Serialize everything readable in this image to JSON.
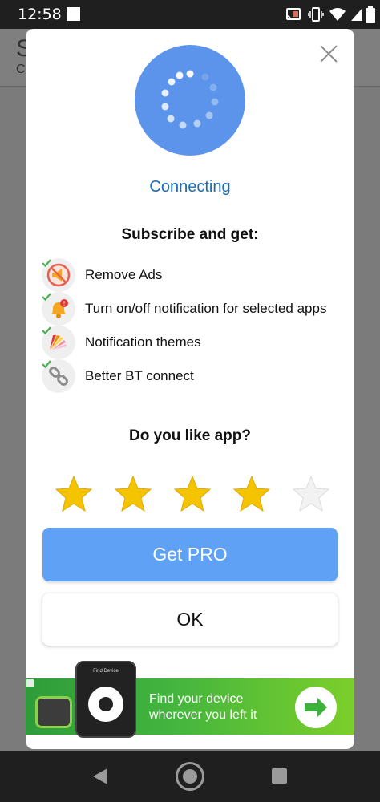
{
  "status_bar": {
    "time": "12:58",
    "icons": [
      "notification-square-icon",
      "cast-icon",
      "vibrate-icon",
      "wifi-icon",
      "signal-icon",
      "battery-icon"
    ]
  },
  "background_app": {
    "title_fragment": "S",
    "subtitle_fragment": "C"
  },
  "dialog": {
    "status_text": "Connecting",
    "subscribe_heading": "Subscribe and get:",
    "features": [
      {
        "label": "Remove Ads",
        "icon": "no-ads-megaphone-icon"
      },
      {
        "label": "Turn on/off notification for selected apps",
        "icon": "bell-alert-icon"
      },
      {
        "label": "Notification themes",
        "icon": "color-palette-fan-icon"
      },
      {
        "label": "Better BT connect",
        "icon": "chain-link-icon"
      }
    ],
    "rating_question": "Do you like app?",
    "rating": {
      "value": 4,
      "max": 5
    },
    "get_pro_label": "Get PRO",
    "ok_label": "OK",
    "colors": {
      "accent_blue": "#5b94ea",
      "pro_button": "#5ea1f5",
      "connecting_text": "#1c6bb5",
      "star": "#f5c400",
      "check_green": "#4caf50"
    }
  },
  "ad_banner": {
    "phone_title": "Find Device",
    "line1": "Find your device",
    "line2": "wherever  you left it"
  }
}
